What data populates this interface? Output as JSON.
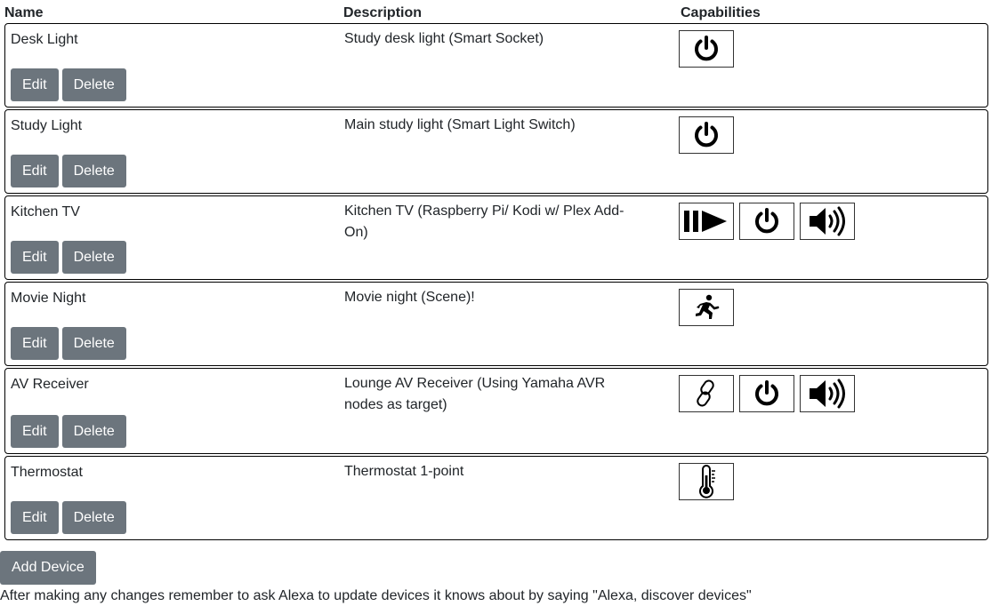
{
  "headers": {
    "name": "Name",
    "description": "Description",
    "capabilities": "Capabilities"
  },
  "buttons": {
    "edit": "Edit",
    "delete": "Delete"
  },
  "devices": [
    {
      "name": "Desk Light",
      "description": "Study desk light (Smart Socket)",
      "capabilities": [
        "power-icon"
      ]
    },
    {
      "name": "Study Light",
      "description": "Main study light (Smart Light Switch)",
      "capabilities": [
        "power-icon"
      ]
    },
    {
      "name": "Kitchen TV",
      "description": "Kitchen TV (Raspberry Pi/ Kodi w/ Plex Add-On)",
      "capabilities": [
        "play-pause-icon",
        "power-icon",
        "volume-icon"
      ]
    },
    {
      "name": "Movie Night",
      "description": "Movie night (Scene)!",
      "capabilities": [
        "running-person-icon"
      ]
    },
    {
      "name": "AV Receiver",
      "description": "Lounge AV Receiver (Using Yamaha AVR nodes as target)",
      "capabilities": [
        "input-link-icon",
        "power-icon",
        "volume-icon"
      ]
    },
    {
      "name": "Thermostat",
      "description": "Thermostat 1-point",
      "capabilities": [
        "thermometer-icon"
      ]
    }
  ],
  "add_device_label": "Add Device",
  "footer_note": "After making any changes remember to ask Alexa to update devices it knows about by saying \"Alexa, discover devices\""
}
